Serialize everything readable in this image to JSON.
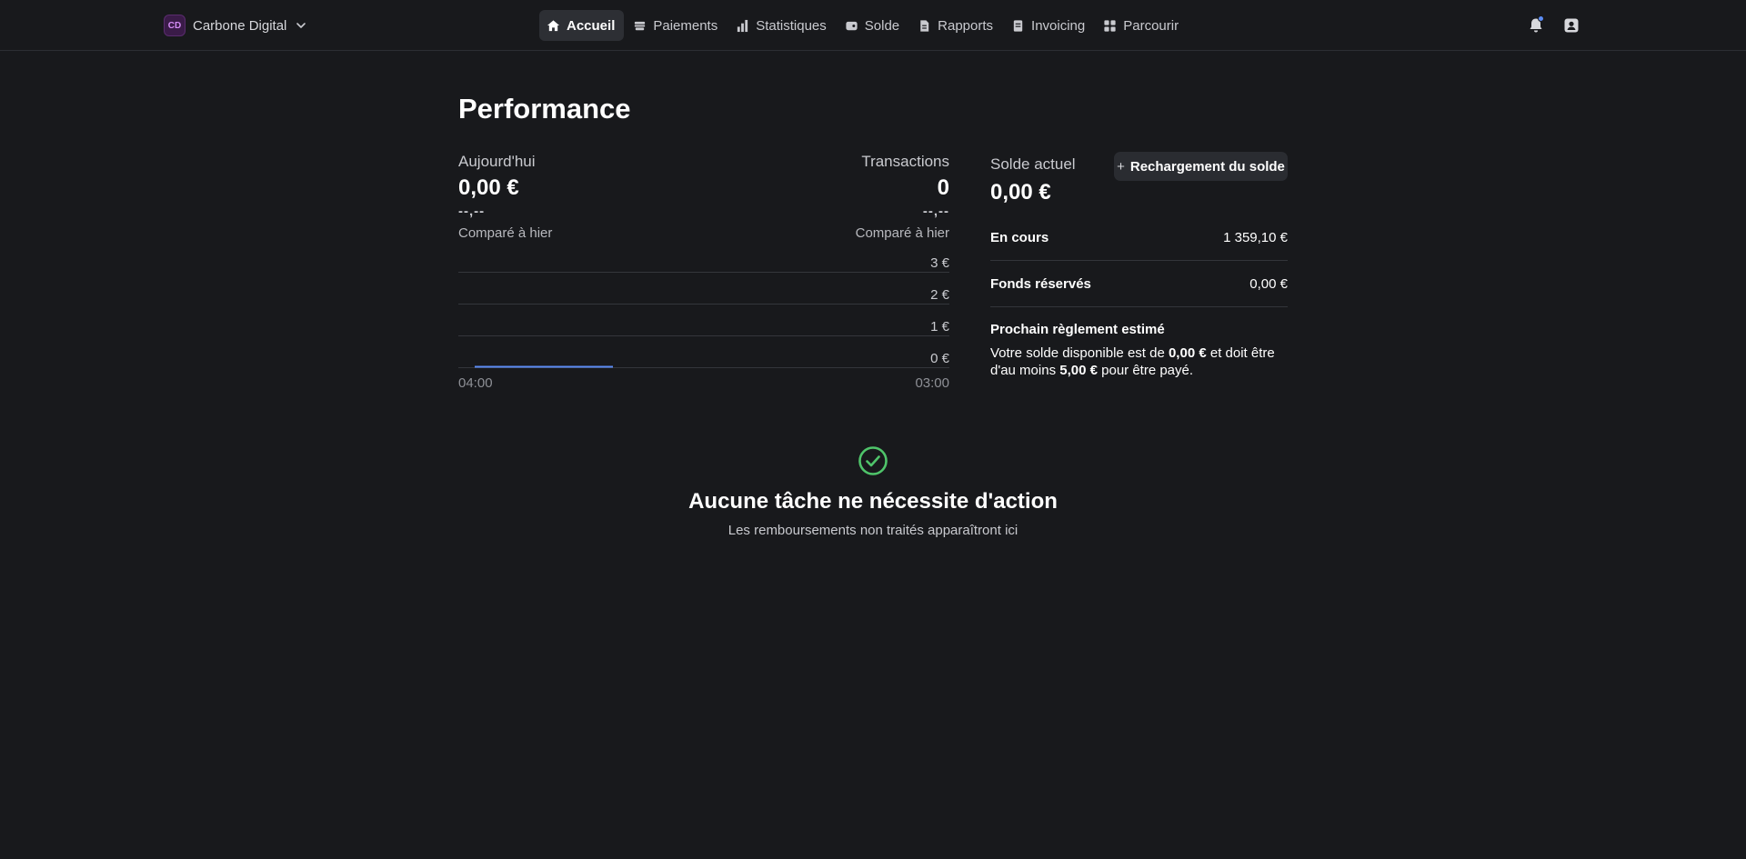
{
  "org": {
    "initials": "CD",
    "name": "Carbone Digital"
  },
  "nav": {
    "items": [
      {
        "label": "Accueil",
        "icon": "home-icon",
        "active": true
      },
      {
        "label": "Paiements",
        "icon": "payments-icon",
        "active": false
      },
      {
        "label": "Statistiques",
        "icon": "bar-chart-icon",
        "active": false
      },
      {
        "label": "Solde",
        "icon": "wallet-icon",
        "active": false
      },
      {
        "label": "Rapports",
        "icon": "report-icon",
        "active": false
      },
      {
        "label": "Invoicing",
        "icon": "invoice-icon",
        "active": false
      },
      {
        "label": "Parcourir",
        "icon": "grid-icon",
        "active": false
      }
    ]
  },
  "header_icons": [
    "bell-icon",
    "account-icon"
  ],
  "colors": {
    "background": "#18191c",
    "accent": "#5b8cf4",
    "success": "#4fc46a",
    "org_avatar": "#d48cf5"
  },
  "performance": {
    "title": "Performance",
    "today": {
      "label": "Aujourd'hui",
      "value": "0,00 €",
      "delta": "--,--",
      "compare": "Comparé à hier"
    },
    "transactions": {
      "label": "Transactions",
      "value": "0",
      "delta": "--,--",
      "compare": "Comparé à hier"
    }
  },
  "chart_data": {
    "type": "line",
    "y_ticks": [
      "3 €",
      "2 €",
      "1 €",
      "0 €"
    ],
    "ylim": [
      0,
      3
    ],
    "x_labels": [
      "04:00",
      "03:00"
    ],
    "series": [
      {
        "values": [
          0,
          0,
          0,
          0,
          0,
          0,
          0,
          0,
          0
        ],
        "color": "#5b8cf4"
      }
    ],
    "grid": true
  },
  "balance": {
    "label": "Solde actuel",
    "value": "0,00 €",
    "topup_label": "Rechargement du solde",
    "rows": [
      {
        "label": "En cours",
        "value": "1 359,10 €"
      },
      {
        "label": "Fonds réservés",
        "value": "0,00 €"
      }
    ],
    "settlement": {
      "title": "Prochain règlement estimé",
      "text_1": "Votre solde disponible est de ",
      "amount_available": "0,00 €",
      "text_2": " et doit être d'au moins ",
      "amount_minimum": "5,00 €",
      "text_3": " pour être payé."
    }
  },
  "empty_state": {
    "icon": "check-circle-icon",
    "title": "Aucune tâche ne nécessite d'action",
    "subtitle": "Les remboursements non traités apparaîtront ici"
  }
}
